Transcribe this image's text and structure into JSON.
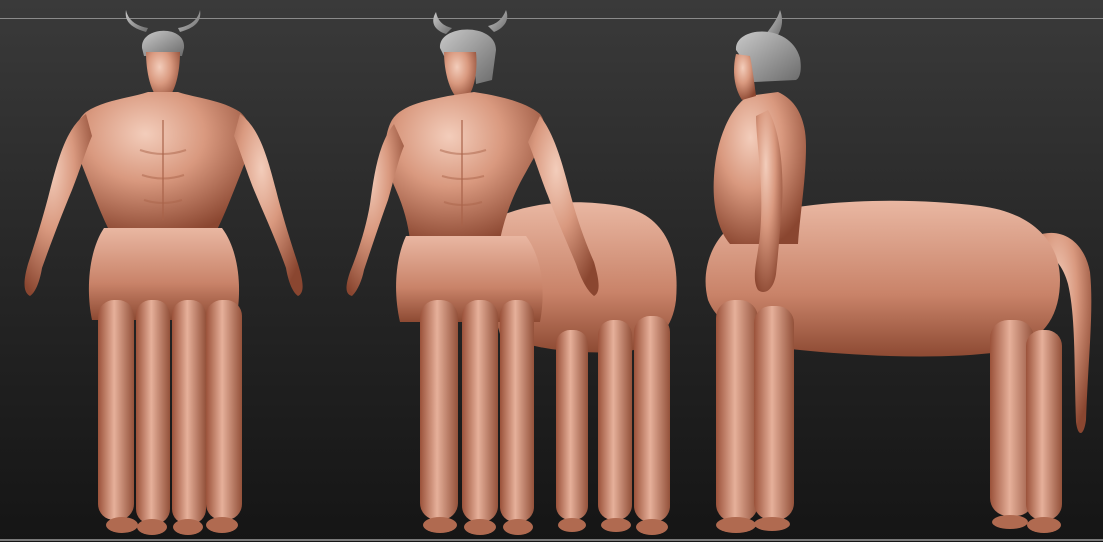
{
  "scene": {
    "subject": "",
    "views": [
      {
        "name": "front-view"
      },
      {
        "name": "three-quarter-view"
      },
      {
        "name": "side-view"
      }
    ]
  },
  "colors": {
    "background_top": "#3a3a3a",
    "background_bottom": "#151515",
    "clay_light": "#f0c3b0",
    "clay_mid": "#cf8e74",
    "clay_dark": "#7a3e2a",
    "helmet": "#9a9a9a",
    "frame_line": "#8a8a8a"
  }
}
